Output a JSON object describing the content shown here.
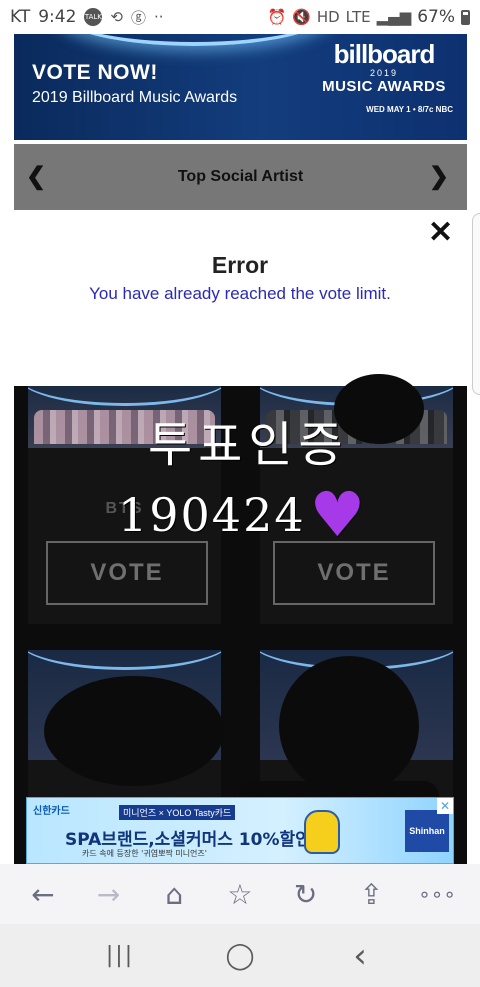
{
  "status_bar": {
    "carrier": "KT",
    "time": "9:42",
    "talk_badge": "TALK",
    "network": "LTE",
    "battery": "67%"
  },
  "banner": {
    "headline": "VOTE NOW!",
    "subtitle": "2019 Billboard Music Awards",
    "logo_word": "billboard",
    "logo_year": "2019",
    "logo_line": "MUSIC AWARDS",
    "airdate": "WED MAY 1 • 8/7c NBC"
  },
  "category": {
    "title": "Top Social Artist",
    "prev_icon": "chevron-left-icon",
    "next_icon": "chevron-right-icon"
  },
  "error": {
    "close_label": "✕",
    "title": "Error",
    "message": "You have already reached the vote limit."
  },
  "artists": {
    "card1_name": "BTS",
    "vote_label": "VOTE"
  },
  "overlay": {
    "line1": "투표인증",
    "line2": "190424",
    "heart": "♥"
  },
  "ad": {
    "brand": "신한카드",
    "tag": "미니언즈 × YOLO Tasty카드",
    "headline": "SPA브랜드,소셜커머스 10%할인",
    "small": "카드 속에 등장한 '귀염뽀짝 미니언즈'",
    "badge": "Shinhan",
    "close": "✕"
  },
  "toolbar": {
    "back": "←",
    "forward": "→",
    "home": "⌂",
    "bookmark": "☆",
    "refresh": "↻",
    "share": "⇪",
    "more": "∘∘∘"
  },
  "navbar": {
    "recents": "|||",
    "home": "◯",
    "back": "‹"
  },
  "colors": {
    "error_text": "#2a2ab8",
    "category_bg": "#777777",
    "banner_bg": "#0a2a5c",
    "heart": "#a63ae8"
  }
}
